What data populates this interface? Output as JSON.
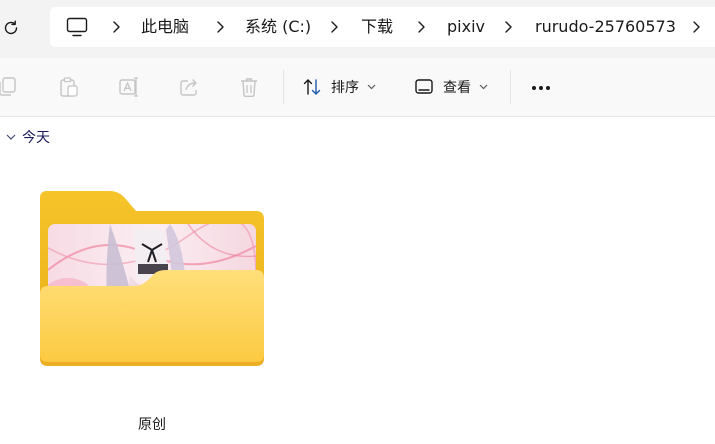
{
  "address_bar": {
    "refresh_icon": "refresh-icon",
    "computer_icon": "computer-monitor-icon",
    "separator_icon": "chevron-right-icon",
    "crumbs": [
      "此电脑",
      "系统 (C:)",
      "下载",
      "pixiv",
      "rurudo-25760573"
    ]
  },
  "toolbar": {
    "copy_icon": "copy-icon",
    "paste_icon": "paste-icon",
    "rename_icon": "rename-icon",
    "share_icon": "share-icon",
    "delete_icon": "trash-icon",
    "sort_label": "排序",
    "view_label": "查看",
    "more_icon": "more-horizontal-icon"
  },
  "content": {
    "group_label": "今天",
    "items": [
      {
        "name": "原创",
        "type": "folder",
        "icon": "folder-with-thumbnail-icon"
      }
    ]
  },
  "colors": {
    "folder_back": "#f2bd22",
    "folder_front": "#ffd257",
    "address_bg": "#f3f3f3",
    "toolbar_bg": "#f9f9f9",
    "disabled_icon": "#c5c5c5"
  }
}
